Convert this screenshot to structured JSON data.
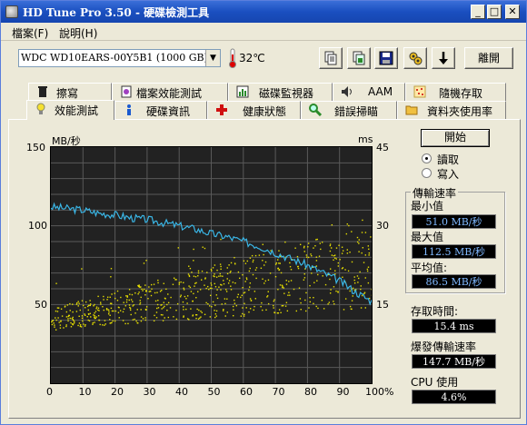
{
  "window": {
    "title": "HD Tune Pro 3.50 - 硬碟檢測工具",
    "min": "_",
    "max": "□",
    "close": "✕"
  },
  "menu": [
    "檔案(F)",
    "說明(H)"
  ],
  "toolbar": {
    "drive": "WDC WD10EARS-00Y5B1 (1000 GB)",
    "temperature": "32℃",
    "icons": [
      "copy-text-icon",
      "copy-image-icon",
      "save-icon",
      "options-icon",
      "download-icon"
    ],
    "exit_label": "離開"
  },
  "tabs_top": [
    {
      "label": "擦寫",
      "icon": "trash-icon"
    },
    {
      "label": "檔案效能測試",
      "icon": "file-benchmark-icon"
    },
    {
      "label": "磁碟監視器",
      "icon": "chart-icon"
    },
    {
      "label": "AAM",
      "icon": "speaker-icon"
    },
    {
      "label": "隨機存取",
      "icon": "random-access-icon"
    }
  ],
  "tabs_bottom": [
    {
      "label": "效能測試",
      "icon": "bulb-icon",
      "active": true
    },
    {
      "label": "硬碟資訊",
      "icon": "info-icon"
    },
    {
      "label": "健康狀態",
      "icon": "health-cross-icon"
    },
    {
      "label": "錯誤掃瞄",
      "icon": "search-icon"
    },
    {
      "label": "資料夾使用率",
      "icon": "folder-icon"
    }
  ],
  "chart": {
    "y_left_unit": "MB/秒",
    "y_right_unit": "ms",
    "y_left_ticks": [
      "150",
      "100",
      "50"
    ],
    "y_right_ticks": [
      "45",
      "30",
      "15"
    ],
    "x_ticks": [
      "0",
      "10",
      "20",
      "30",
      "40",
      "50",
      "60",
      "70",
      "80",
      "90",
      "100%"
    ]
  },
  "chart_data": {
    "type": "line",
    "xlabel": "",
    "ylabel": "MB/秒",
    "y2label": "ms",
    "xlim": [
      0,
      100
    ],
    "ylim": [
      0,
      150
    ],
    "y2lim": [
      0,
      45
    ],
    "grid": true,
    "series": [
      {
        "axis": "left",
        "color": "#3ab6e6",
        "x": [
          0,
          5,
          10,
          15,
          20,
          25,
          30,
          35,
          40,
          45,
          50,
          55,
          60,
          65,
          70,
          75,
          80,
          85,
          90,
          95,
          100
        ],
        "values": [
          112,
          111,
          110,
          108,
          107,
          105,
          104,
          102,
          100,
          98,
          95,
          93,
          90,
          87,
          83,
          79,
          75,
          70,
          65,
          58,
          52
        ]
      },
      {
        "axis": "right",
        "type": "scatter",
        "color": "#e8e000",
        "x": [
          0,
          5,
          10,
          15,
          20,
          25,
          30,
          35,
          40,
          45,
          50,
          55,
          60,
          65,
          70,
          75,
          80,
          85,
          90,
          95,
          100
        ],
        "values": [
          12,
          13,
          13.5,
          14,
          14.5,
          15,
          15.5,
          16,
          16.5,
          17,
          17.5,
          18,
          18.5,
          19,
          19.5,
          20,
          20.5,
          21,
          21.5,
          22,
          22.5
        ]
      }
    ]
  },
  "controls": {
    "start_label": "開始",
    "read_label": "讀取",
    "write_label": "寫入"
  },
  "transfer": {
    "title": "傳輸速率",
    "min_label": "最小值",
    "min_value": "51.0 MB/秒",
    "max_label": "最大值",
    "max_value": "112.5 MB/秒",
    "avg_label": "平均值:",
    "avg_value": "86.5 MB/秒"
  },
  "stats": {
    "access_label": "存取時間:",
    "access_value": "15.4 ms",
    "burst_label": "爆發傳輸速率",
    "burst_value": "147.7 MB/秒",
    "cpu_label": "CPU 使用",
    "cpu_value": "4.6%"
  },
  "colors": {
    "transfer_line": "#3ab6e6",
    "access_dots": "#e8e000",
    "chart_bg": "#222222",
    "grid": "#5a5a5a"
  }
}
